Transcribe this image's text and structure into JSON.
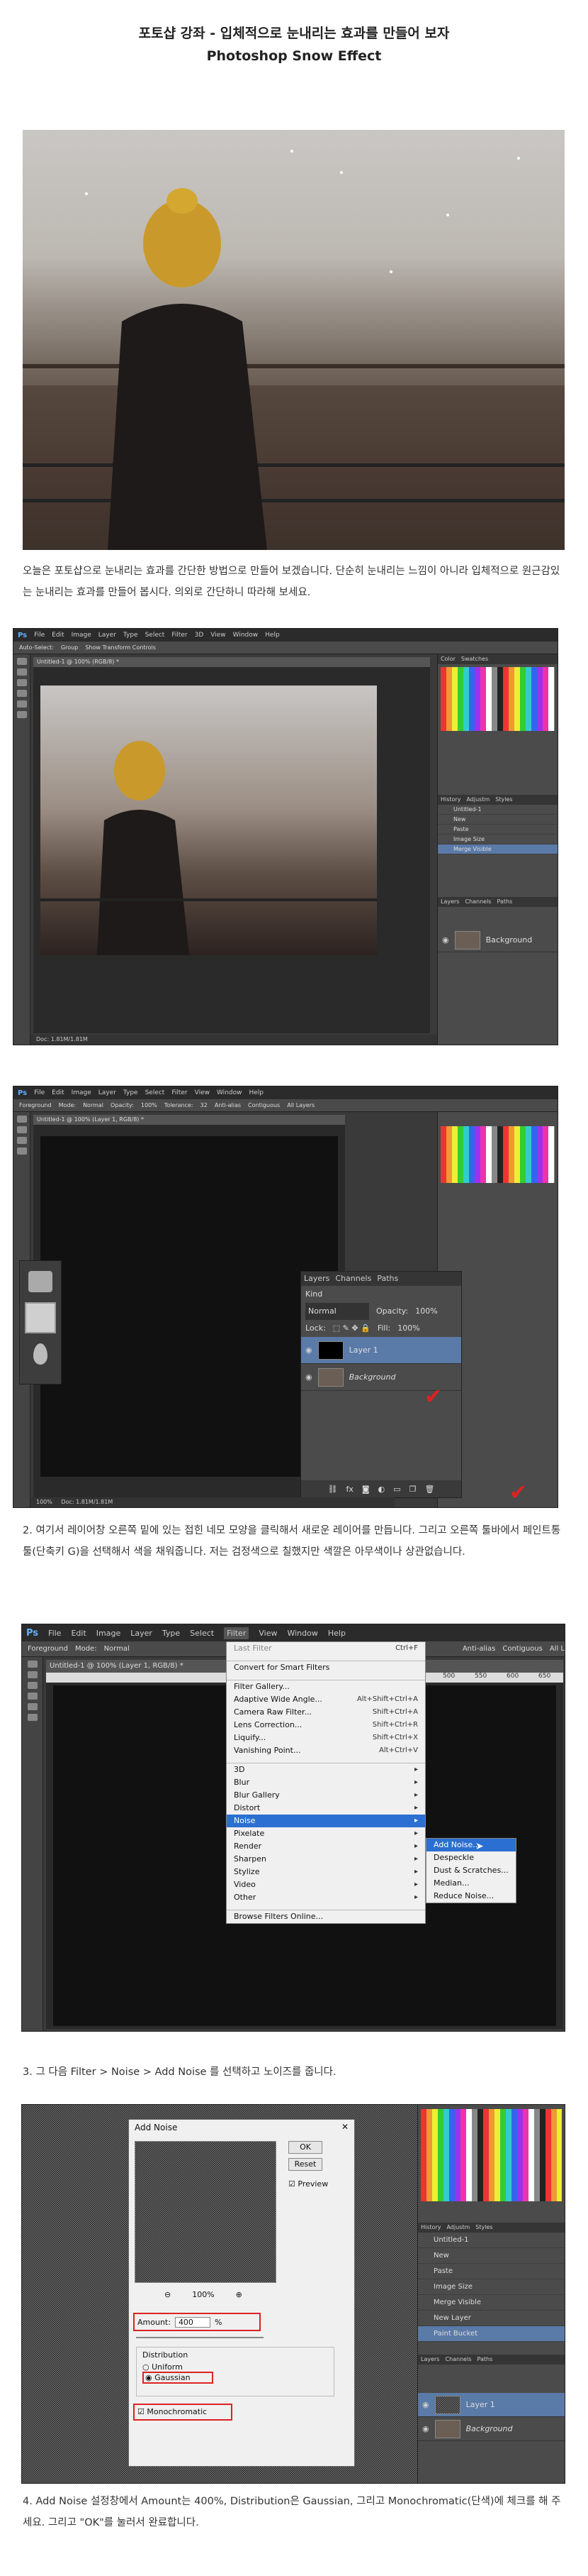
{
  "title": "포토샵 강좌 - 입체적으로 눈내리는 효과를 만들어 보자",
  "subtitle": "Photoshop Snow Effect",
  "intro": "오늘은 포토샵으로 눈내리는 효과를 간단한 방법으로 만들어 보겠습니다. 단순히 눈내리는 느낌이 아니라 입체적으로 원근감있는 눈내리는 효과를 만들어 봅시다. 의외로 간단하니 따라해 보세요.",
  "ps1": {
    "menu": [
      "Ps",
      "File",
      "Edit",
      "Image",
      "Layer",
      "Type",
      "Select",
      "Filter",
      "3D",
      "View",
      "Window",
      "Help"
    ],
    "options": [
      "Auto-Select:",
      "Group",
      "Show Transform Controls"
    ],
    "doc_tab": "Untitled-1 @ 100% (RGB/8) *",
    "panel_tabs": [
      "Color",
      "Swatches"
    ],
    "history_tabs": [
      "History",
      "Adjustm",
      "Styles"
    ],
    "history": [
      "Untitled-1",
      "New",
      "Paste",
      "Image Size",
      "Merge Visible"
    ],
    "layers_tabs": [
      "Layers",
      "Channels",
      "Paths"
    ],
    "layer_name": "Background",
    "status": "Doc: 1.81M/1.81M"
  },
  "ps2": {
    "menu": [
      "Ps",
      "File",
      "Edit",
      "Image",
      "Layer",
      "Type",
      "Select",
      "Filter",
      "View",
      "Window",
      "Help"
    ],
    "options": [
      "Foreground",
      "Mode:",
      "Normal",
      "Opacity:",
      "100%",
      "Tolerance:",
      "32",
      "Anti-alias",
      "Contiguous",
      "All Layers"
    ],
    "doc_tab": "Untitled-1 @ 100% (Layer 1, RGB/8) *",
    "layers_tabs": [
      "Layers",
      "Channels",
      "Paths"
    ],
    "kind": "Kind",
    "blend": "Normal",
    "opacity_label": "Opacity:",
    "opacity": "100%",
    "lock_label": "Lock:",
    "fill_label": "Fill:",
    "fill": "100%",
    "layer1": "Layer 1",
    "background": "Background",
    "status": "Doc: 1.81M/1.81M",
    "zoom": "100%"
  },
  "step2": "2. 여기서 레이어창 오른쪽 밑에 있는 접힌 네모 모양을 클릭해서 새로운 레이어를 만듭니다. 그리고 오른쪽 툴바에서 페인트통툴(단축키 G)을 선택해서 색을 채워줍니다. 저는 검정색으로 칠했지만 색깔은 아무색이나 상관없습니다.",
  "ps3": {
    "menu": [
      "Ps",
      "File",
      "Edit",
      "Image",
      "Layer",
      "Type",
      "Select",
      "Filter",
      "View",
      "Window",
      "Help"
    ],
    "options": [
      "Foreground",
      "Mode:",
      "Normal",
      "Anti-alias",
      "Contiguous",
      "All L"
    ],
    "doc_tab": "Untitled-1 @ 100% (Layer 1, RGB/8) *",
    "filter_menu": [
      {
        "label": "Last Filter",
        "sc": "Ctrl+F"
      },
      {
        "label": "Convert for Smart Filters",
        "sc": ""
      },
      {
        "label": "Filter Gallery...",
        "sc": ""
      },
      {
        "label": "Adaptive Wide Angle...",
        "sc": "Alt+Shift+Ctrl+A"
      },
      {
        "label": "Camera Raw Filter...",
        "sc": "Shift+Ctrl+A"
      },
      {
        "label": "Lens Correction...",
        "sc": "Shift+Ctrl+R"
      },
      {
        "label": "Liquify...",
        "sc": "Shift+Ctrl+X"
      },
      {
        "label": "Vanishing Point...",
        "sc": "Alt+Ctrl+V"
      },
      {
        "label": "3D",
        "sc": "▸"
      },
      {
        "label": "Blur",
        "sc": "▸"
      },
      {
        "label": "Blur Gallery",
        "sc": "▸"
      },
      {
        "label": "Distort",
        "sc": "▸"
      },
      {
        "label": "Noise",
        "sc": "▸"
      },
      {
        "label": "Pixelate",
        "sc": "▸"
      },
      {
        "label": "Render",
        "sc": "▸"
      },
      {
        "label": "Sharpen",
        "sc": "▸"
      },
      {
        "label": "Stylize",
        "sc": "▸"
      },
      {
        "label": "Video",
        "sc": "▸"
      },
      {
        "label": "Other",
        "sc": "▸"
      },
      {
        "label": "Browse Filters Online...",
        "sc": ""
      }
    ],
    "noise_submenu": [
      "Add Noise...",
      "Despeckle",
      "Dust & Scratches...",
      "Median...",
      "Reduce Noise..."
    ],
    "ruler": [
      "500",
      "550",
      "600",
      "650"
    ]
  },
  "step3": "3. 그 다음 Filter > Noise > Add Noise 를 선택하고 노이즈를 줍니다.",
  "ps4": {
    "dialog_title": "Add Noise",
    "ok": "OK",
    "reset": "Reset",
    "preview": "Preview",
    "zoom": "100%",
    "amount_label": "Amount:",
    "amount": "400",
    "percent": "%",
    "distribution": "Distribution",
    "uniform": "Uniform",
    "gaussian": "Gaussian",
    "mono": "Monochromatic",
    "history": [
      "Untitled-1",
      "New",
      "Paste",
      "Image Size",
      "Merge Visible",
      "New Layer",
      "Paint Bucket"
    ],
    "history_tabs": [
      "History",
      "Adjustm",
      "Styles"
    ],
    "layers_tabs": [
      "Layers",
      "Channels",
      "Paths"
    ],
    "layer1": "Layer 1",
    "background": "Background"
  },
  "step4": "4. Add Noise 설정창에서 Amount는 400%, Distribution은 Gaussian, 그리고 Monochromatic(단색)에 체크를 해 주세요. 그리고 \"OK\"를 눌러서 완료합니다."
}
